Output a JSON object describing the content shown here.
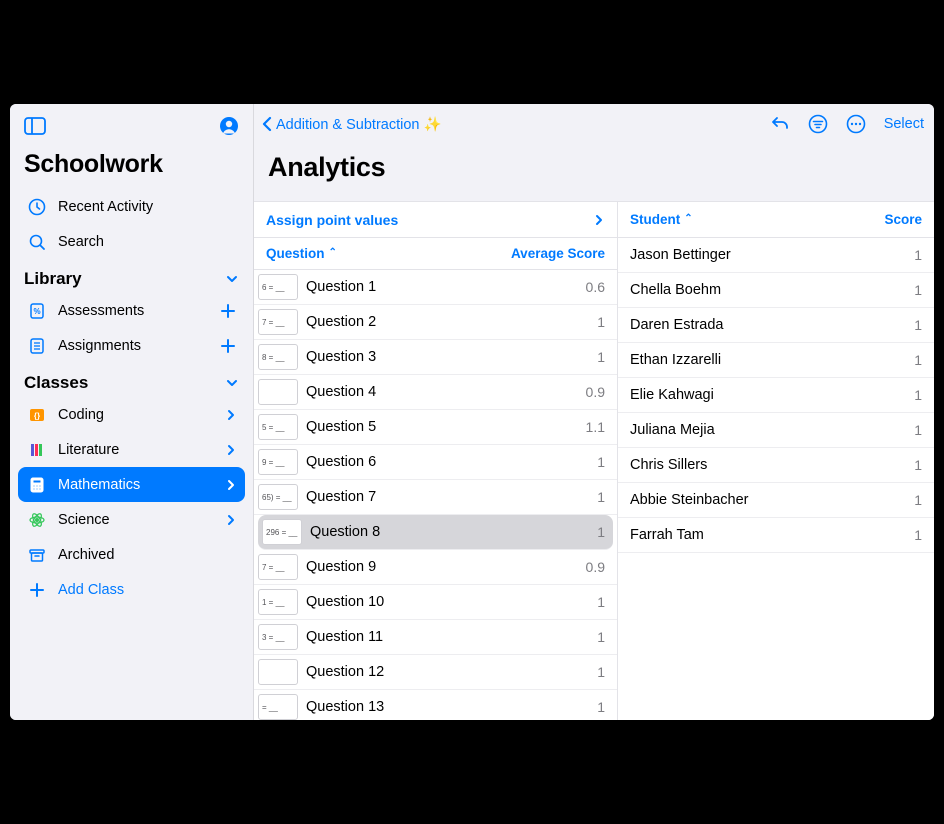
{
  "colors": {
    "accent": "#007aff"
  },
  "sidebar": {
    "app_title": "Schoolwork",
    "recent_label": "Recent Activity",
    "search_label": "Search",
    "library_header": "Library",
    "assessments_label": "Assessments",
    "assignments_label": "Assignments",
    "classes_header": "Classes",
    "classes": [
      {
        "label": "Coding"
      },
      {
        "label": "Literature"
      },
      {
        "label": "Mathematics"
      },
      {
        "label": "Science"
      }
    ],
    "archived_label": "Archived",
    "add_class_label": "Add Class"
  },
  "main": {
    "back_label": "Addition & Subtraction ✨",
    "select_label": "Select",
    "title": "Analytics",
    "assign_label": "Assign point values",
    "question_header": "Question",
    "avg_header": "Average Score",
    "student_header": "Student",
    "score_header": "Score",
    "questions": [
      {
        "thumb": "6 = __",
        "label": "Question 1",
        "score": "0.6"
      },
      {
        "thumb": "7 = __",
        "label": "Question 2",
        "score": "1"
      },
      {
        "thumb": "8 = __",
        "label": "Question 3",
        "score": "1"
      },
      {
        "thumb": "",
        "label": "Question 4",
        "score": "0.9"
      },
      {
        "thumb": "5 = __",
        "label": "Question 5",
        "score": "1.1"
      },
      {
        "thumb": "9 = __",
        "label": "Question 6",
        "score": "1"
      },
      {
        "thumb": "65) = __",
        "label": "Question 7",
        "score": "1"
      },
      {
        "thumb": "296 = __",
        "label": "Question 8",
        "score": "1",
        "selected": true
      },
      {
        "thumb": "7 = __",
        "label": "Question 9",
        "score": "0.9"
      },
      {
        "thumb": "1 = __",
        "label": "Question 10",
        "score": "1"
      },
      {
        "thumb": "3 = __",
        "label": "Question 11",
        "score": "1"
      },
      {
        "thumb": "",
        "label": "Question 12",
        "score": "1"
      },
      {
        "thumb": "= __",
        "label": "Question 13",
        "score": "1"
      }
    ],
    "students": [
      {
        "name": "Jason Bettinger",
        "score": "1"
      },
      {
        "name": "Chella Boehm",
        "score": "1"
      },
      {
        "name": "Daren Estrada",
        "score": "1"
      },
      {
        "name": "Ethan Izzarelli",
        "score": "1"
      },
      {
        "name": "Elie Kahwagi",
        "score": "1"
      },
      {
        "name": "Juliana Mejia",
        "score": "1"
      },
      {
        "name": "Chris Sillers",
        "score": "1"
      },
      {
        "name": "Abbie Steinbacher",
        "score": "1"
      },
      {
        "name": "Farrah Tam",
        "score": "1"
      }
    ]
  }
}
